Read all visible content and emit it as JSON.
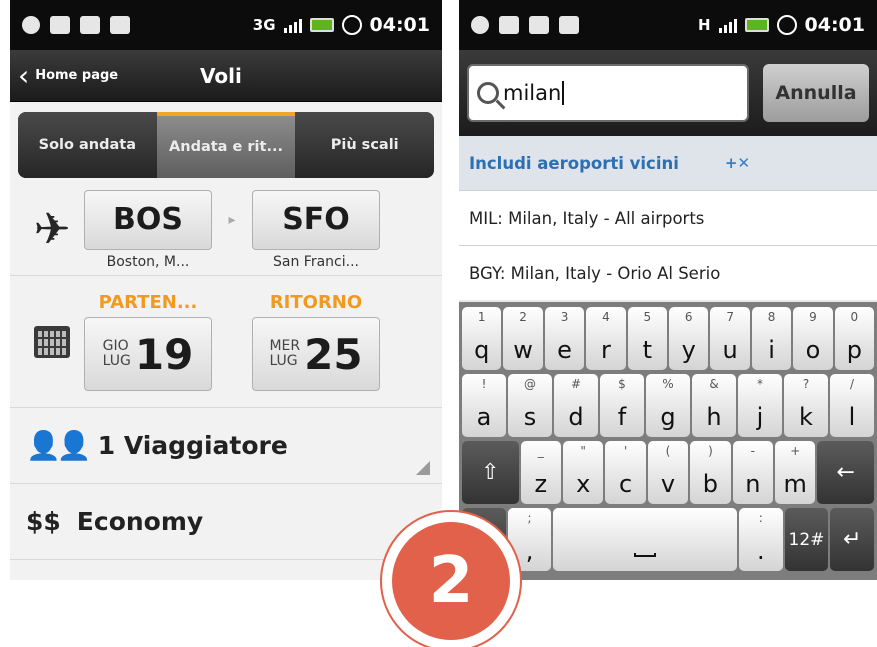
{
  "left": {
    "status": {
      "network": "3G",
      "time": "04:01"
    },
    "titlebar": {
      "back_label": "Home page",
      "title": "Voli"
    },
    "tabs": [
      {
        "label": "Solo andata",
        "active": false
      },
      {
        "label": "Andata e rit...",
        "active": true
      },
      {
        "label": "Più scali",
        "active": false
      }
    ],
    "route": {
      "from_code": "BOS",
      "from_city": "Boston, M...",
      "to_code": "SFO",
      "to_city": "San Franci..."
    },
    "dates": {
      "departure": {
        "label": "PARTEN...",
        "weekday": "GIO",
        "month": "LUG",
        "day": "19"
      },
      "return": {
        "label": "RITORNO",
        "weekday": "MER",
        "month": "LUG",
        "day": "25"
      }
    },
    "travelers": "1 Viaggiatore",
    "cabin": {
      "icon": "$$",
      "label": "Economy"
    }
  },
  "right": {
    "status": {
      "network": "H",
      "time": "04:01"
    },
    "search": {
      "value": "milan",
      "cancel_label": "Annulla"
    },
    "nearby": {
      "label": "Includi aeroporti vicini",
      "toggle": "+✕"
    },
    "results": [
      "MIL: Milan, Italy - All airports",
      "BGY: Milan, Italy - Orio Al Serio"
    ],
    "keyboard": {
      "row1": [
        {
          "k": "q",
          "s": "1"
        },
        {
          "k": "w",
          "s": "2"
        },
        {
          "k": "e",
          "s": "3"
        },
        {
          "k": "r",
          "s": "4"
        },
        {
          "k": "t",
          "s": "5"
        },
        {
          "k": "y",
          "s": "6"
        },
        {
          "k": "u",
          "s": "7"
        },
        {
          "k": "i",
          "s": "8"
        },
        {
          "k": "o",
          "s": "9"
        },
        {
          "k": "p",
          "s": "0"
        }
      ],
      "row2": [
        {
          "k": "a",
          "s": "!"
        },
        {
          "k": "s",
          "s": "@"
        },
        {
          "k": "d",
          "s": "#"
        },
        {
          "k": "f",
          "s": "$"
        },
        {
          "k": "g",
          "s": "%"
        },
        {
          "k": "h",
          "s": "&"
        },
        {
          "k": "j",
          "s": "*"
        },
        {
          "k": "k",
          "s": "?"
        },
        {
          "k": "l",
          "s": "/"
        }
      ],
      "row3": [
        {
          "k": "z",
          "s": "_"
        },
        {
          "k": "x",
          "s": "\""
        },
        {
          "k": "c",
          "s": "'"
        },
        {
          "k": "v",
          "s": "("
        },
        {
          "k": "b",
          "s": ")"
        },
        {
          "k": "n",
          "s": "-"
        },
        {
          "k": "m",
          "s": "+"
        }
      ],
      "row4_comma": {
        "k": ",",
        "s": ";"
      },
      "row4_period": {
        "k": ".",
        "s": ":"
      },
      "row4_symbols": "12#"
    }
  },
  "badge": {
    "number": "2"
  },
  "colors": {
    "accent_orange": "#f29a1e",
    "link_blue": "#2c6fb3",
    "badge_red": "#e2614a"
  }
}
